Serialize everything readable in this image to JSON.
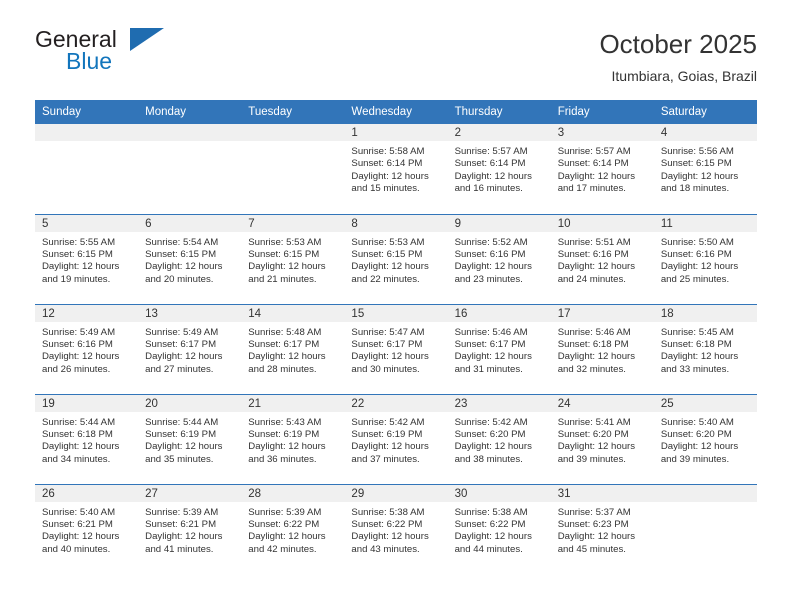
{
  "logo": {
    "word1": "General",
    "word2": "Blue",
    "triangle_color": "#1f6cb0",
    "word2_color": "#1275bc"
  },
  "header": {
    "title": "October 2025",
    "subtitle": "Itumbiara, Goias, Brazil"
  },
  "theme": {
    "header_bg": "#3275b9",
    "daynum_bg": "#f0f0f0",
    "grid_line": "#3275b9",
    "text": "#333333"
  },
  "calendar": {
    "weekday_headers": [
      "Sunday",
      "Monday",
      "Tuesday",
      "Wednesday",
      "Thursday",
      "Friday",
      "Saturday"
    ],
    "weeks": [
      [
        {
          "day": "",
          "lines": []
        },
        {
          "day": "",
          "lines": []
        },
        {
          "day": "",
          "lines": []
        },
        {
          "day": "1",
          "lines": [
            "Sunrise: 5:58 AM",
            "Sunset: 6:14 PM",
            "Daylight: 12 hours",
            "and 15 minutes."
          ]
        },
        {
          "day": "2",
          "lines": [
            "Sunrise: 5:57 AM",
            "Sunset: 6:14 PM",
            "Daylight: 12 hours",
            "and 16 minutes."
          ]
        },
        {
          "day": "3",
          "lines": [
            "Sunrise: 5:57 AM",
            "Sunset: 6:14 PM",
            "Daylight: 12 hours",
            "and 17 minutes."
          ]
        },
        {
          "day": "4",
          "lines": [
            "Sunrise: 5:56 AM",
            "Sunset: 6:15 PM",
            "Daylight: 12 hours",
            "and 18 minutes."
          ]
        }
      ],
      [
        {
          "day": "5",
          "lines": [
            "Sunrise: 5:55 AM",
            "Sunset: 6:15 PM",
            "Daylight: 12 hours",
            "and 19 minutes."
          ]
        },
        {
          "day": "6",
          "lines": [
            "Sunrise: 5:54 AM",
            "Sunset: 6:15 PM",
            "Daylight: 12 hours",
            "and 20 minutes."
          ]
        },
        {
          "day": "7",
          "lines": [
            "Sunrise: 5:53 AM",
            "Sunset: 6:15 PM",
            "Daylight: 12 hours",
            "and 21 minutes."
          ]
        },
        {
          "day": "8",
          "lines": [
            "Sunrise: 5:53 AM",
            "Sunset: 6:15 PM",
            "Daylight: 12 hours",
            "and 22 minutes."
          ]
        },
        {
          "day": "9",
          "lines": [
            "Sunrise: 5:52 AM",
            "Sunset: 6:16 PM",
            "Daylight: 12 hours",
            "and 23 minutes."
          ]
        },
        {
          "day": "10",
          "lines": [
            "Sunrise: 5:51 AM",
            "Sunset: 6:16 PM",
            "Daylight: 12 hours",
            "and 24 minutes."
          ]
        },
        {
          "day": "11",
          "lines": [
            "Sunrise: 5:50 AM",
            "Sunset: 6:16 PM",
            "Daylight: 12 hours",
            "and 25 minutes."
          ]
        }
      ],
      [
        {
          "day": "12",
          "lines": [
            "Sunrise: 5:49 AM",
            "Sunset: 6:16 PM",
            "Daylight: 12 hours",
            "and 26 minutes."
          ]
        },
        {
          "day": "13",
          "lines": [
            "Sunrise: 5:49 AM",
            "Sunset: 6:17 PM",
            "Daylight: 12 hours",
            "and 27 minutes."
          ]
        },
        {
          "day": "14",
          "lines": [
            "Sunrise: 5:48 AM",
            "Sunset: 6:17 PM",
            "Daylight: 12 hours",
            "and 28 minutes."
          ]
        },
        {
          "day": "15",
          "lines": [
            "Sunrise: 5:47 AM",
            "Sunset: 6:17 PM",
            "Daylight: 12 hours",
            "and 30 minutes."
          ]
        },
        {
          "day": "16",
          "lines": [
            "Sunrise: 5:46 AM",
            "Sunset: 6:17 PM",
            "Daylight: 12 hours",
            "and 31 minutes."
          ]
        },
        {
          "day": "17",
          "lines": [
            "Sunrise: 5:46 AM",
            "Sunset: 6:18 PM",
            "Daylight: 12 hours",
            "and 32 minutes."
          ]
        },
        {
          "day": "18",
          "lines": [
            "Sunrise: 5:45 AM",
            "Sunset: 6:18 PM",
            "Daylight: 12 hours",
            "and 33 minutes."
          ]
        }
      ],
      [
        {
          "day": "19",
          "lines": [
            "Sunrise: 5:44 AM",
            "Sunset: 6:18 PM",
            "Daylight: 12 hours",
            "and 34 minutes."
          ]
        },
        {
          "day": "20",
          "lines": [
            "Sunrise: 5:44 AM",
            "Sunset: 6:19 PM",
            "Daylight: 12 hours",
            "and 35 minutes."
          ]
        },
        {
          "day": "21",
          "lines": [
            "Sunrise: 5:43 AM",
            "Sunset: 6:19 PM",
            "Daylight: 12 hours",
            "and 36 minutes."
          ]
        },
        {
          "day": "22",
          "lines": [
            "Sunrise: 5:42 AM",
            "Sunset: 6:19 PM",
            "Daylight: 12 hours",
            "and 37 minutes."
          ]
        },
        {
          "day": "23",
          "lines": [
            "Sunrise: 5:42 AM",
            "Sunset: 6:20 PM",
            "Daylight: 12 hours",
            "and 38 minutes."
          ]
        },
        {
          "day": "24",
          "lines": [
            "Sunrise: 5:41 AM",
            "Sunset: 6:20 PM",
            "Daylight: 12 hours",
            "and 39 minutes."
          ]
        },
        {
          "day": "25",
          "lines": [
            "Sunrise: 5:40 AM",
            "Sunset: 6:20 PM",
            "Daylight: 12 hours",
            "and 39 minutes."
          ]
        }
      ],
      [
        {
          "day": "26",
          "lines": [
            "Sunrise: 5:40 AM",
            "Sunset: 6:21 PM",
            "Daylight: 12 hours",
            "and 40 minutes."
          ]
        },
        {
          "day": "27",
          "lines": [
            "Sunrise: 5:39 AM",
            "Sunset: 6:21 PM",
            "Daylight: 12 hours",
            "and 41 minutes."
          ]
        },
        {
          "day": "28",
          "lines": [
            "Sunrise: 5:39 AM",
            "Sunset: 6:22 PM",
            "Daylight: 12 hours",
            "and 42 minutes."
          ]
        },
        {
          "day": "29",
          "lines": [
            "Sunrise: 5:38 AM",
            "Sunset: 6:22 PM",
            "Daylight: 12 hours",
            "and 43 minutes."
          ]
        },
        {
          "day": "30",
          "lines": [
            "Sunrise: 5:38 AM",
            "Sunset: 6:22 PM",
            "Daylight: 12 hours",
            "and 44 minutes."
          ]
        },
        {
          "day": "31",
          "lines": [
            "Sunrise: 5:37 AM",
            "Sunset: 6:23 PM",
            "Daylight: 12 hours",
            "and 45 minutes."
          ]
        },
        {
          "day": "",
          "lines": []
        }
      ]
    ]
  }
}
